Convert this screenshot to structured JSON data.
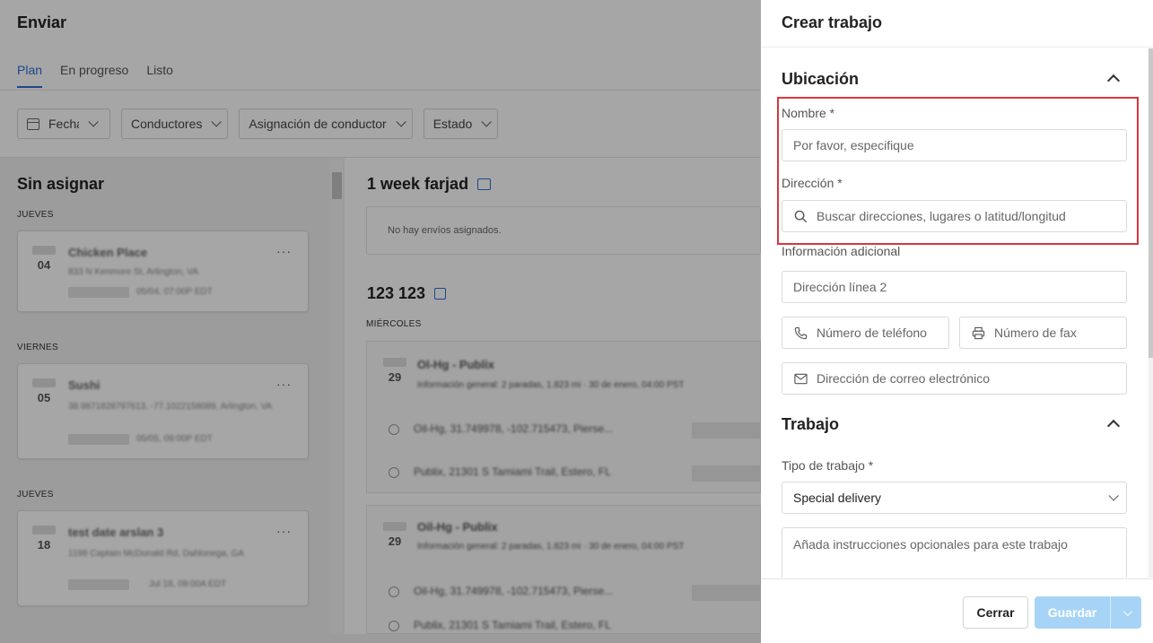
{
  "app": {
    "title": "Enviar",
    "tabs": [
      {
        "label": "Plan",
        "active": true
      },
      {
        "label": "En progreso",
        "active": false
      },
      {
        "label": "Listo",
        "active": false
      }
    ],
    "filters": [
      "Fecha",
      "Conductores",
      "Asignación de conductor",
      "Estado"
    ]
  },
  "unassigned": {
    "title": "Sin asignar",
    "groups": [
      {
        "day": "JUEVES",
        "date": "04",
        "title": "Chicken Place",
        "line1": "833 N Kenmore St, Arlington, VA",
        "line2": "05/04, 07:00P EDT"
      },
      {
        "day": "VIERNES",
        "date": "05",
        "title": "Sushi",
        "line1": "38.9871828797613, -77.1022158089, Arlington, VA",
        "line2": "05/05, 09:00P EDT"
      },
      {
        "day": "JUEVES",
        "date": "18",
        "title": "test date arslan 3",
        "line1": "1198 Captain McDonald Rd, Dahlonega, GA",
        "line2": "Jul 18, 09:00A EDT"
      }
    ]
  },
  "routes": [
    {
      "title": "1 week farjad",
      "empty_text": "No hay envíos asignados."
    },
    {
      "title": "123 123",
      "day": "MIÉRCOLES",
      "stops": [
        {
          "date": "29",
          "title": "Ol-Hg - Publix",
          "meta": "Información general: 2 paradas, 1.823 mi · 30 de enero, 04:00 PST",
          "line1": "Oil-Hg, 31.749978, -102.715473, Pierse...",
          "line2": "Publix, 21301 S Tamiami Trail, Estero, FL"
        },
        {
          "date": "29",
          "title": "Oil-Hg - Publix",
          "meta": "Información general: 2 paradas, 1.823 mi · 30 de enero, 04:00 PST",
          "line1": "Oil-Hg, 31.749978, -102.715473, Pierse...",
          "line2": "Publix, 21301 S Tamiami Trail, Estero, FL"
        }
      ]
    }
  ],
  "drawer": {
    "title": "Crear trabajo",
    "location_section": "Ubicación",
    "name_label": "Nombre *",
    "name_placeholder": "Por favor, especifique",
    "address_label": "Dirección *",
    "address_placeholder": "Buscar direcciones, lugares o latitud/longitud",
    "additional_label": "Información adicional",
    "address2_placeholder": "Dirección línea 2",
    "phone_placeholder": "Número de teléfono",
    "fax_placeholder": "Número de fax",
    "email_placeholder": "Dirección de correo electrónico",
    "job_section": "Trabajo",
    "job_type_label": "Tipo de trabajo *",
    "job_type_value": "Special delivery",
    "instructions_placeholder": "Añada instrucciones opcionales para este trabajo",
    "close_label": "Cerrar",
    "save_label": "Guardar"
  },
  "colors": {
    "accent": "#2b6fd6",
    "highlight": "#d9363e",
    "save_button": "#a7d4f6"
  }
}
